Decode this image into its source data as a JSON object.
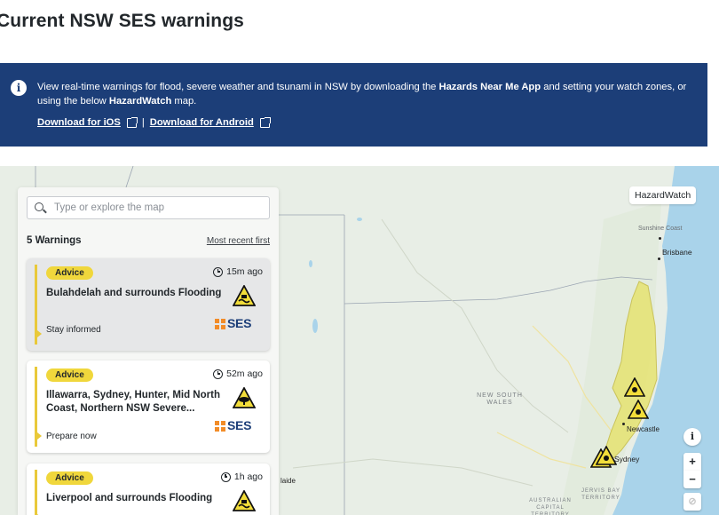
{
  "page": {
    "title": "Current NSW SES warnings"
  },
  "banner": {
    "message_prefix": "View real-time warnings for flood, severe weather and tsunami in NSW by downloading the",
    "app_name": "Hazards Near Me App",
    "message_mid": "and setting your watch zones, or using the below",
    "map_name": "HazardWatch",
    "message_suffix": "map.",
    "ios_link": "Download for iOS",
    "separator": "|",
    "android_link": "Download for Android",
    "info_icon": "info-icon",
    "external_icon": "external-link-icon"
  },
  "panel": {
    "search_placeholder": "Type or explore the map",
    "count_label": "5 Warnings",
    "sort_label": "Most recent first",
    "warnings": [
      {
        "level": "Advice",
        "time": "15m ago",
        "title": "Bulahdelah and surrounds Flooding",
        "action": "Stay informed",
        "icon": "flood-warning-icon",
        "logo": "SES"
      },
      {
        "level": "Advice",
        "time": "52m ago",
        "title": "Illawarra, Sydney, Hunter, Mid North Coast, Northern NSW Severe...",
        "action": "Prepare now",
        "icon": "severe-weather-warning-icon",
        "logo": "SES"
      },
      {
        "level": "Advice",
        "time": "1h ago",
        "title": "Liverpool and surrounds Flooding",
        "icon": "flood-warning-icon"
      }
    ]
  },
  "map": {
    "brand_label": "HazardWatch",
    "places": {
      "sunshine_coast": "Sunshine Coast",
      "brisbane": "Brisbane",
      "newcastle": "Newcastle",
      "sydney": "Sydney",
      "adelaide_partial": "laide",
      "jervis_bay": "JERVIS BAY TERRITORY",
      "act": "AUSTRALIAN CAPITAL TERRITORY",
      "nsw": "NEW SOUTH WALES"
    },
    "controls": {
      "info": "i",
      "zoom_in": "+",
      "zoom_out": "−"
    },
    "colors": {
      "land": "#e8eee6",
      "water": "#a9d3ea",
      "warning_area": "#e6e36b",
      "banner": "#1c3e78",
      "advice_badge": "#f0d73c"
    }
  }
}
